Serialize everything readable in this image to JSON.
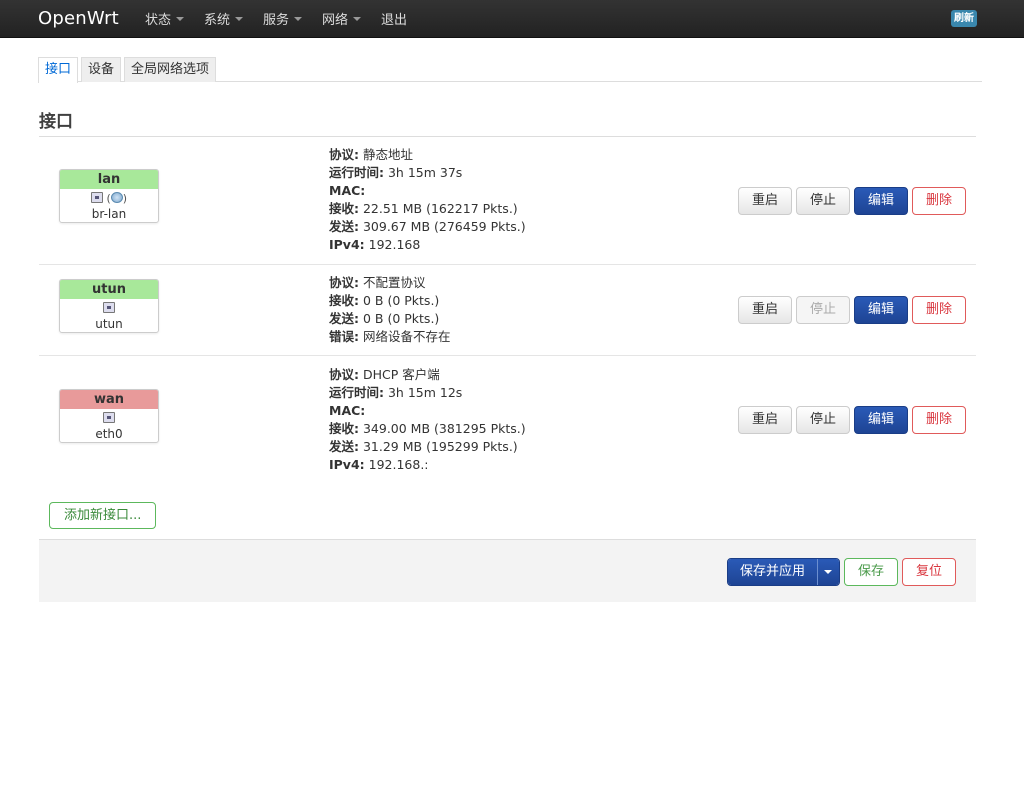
{
  "navbar": {
    "brand": "OpenWrt",
    "menus": [
      "状态",
      "系统",
      "服务",
      "网络"
    ],
    "logout": "退出",
    "refresh": "刷新"
  },
  "tabs": [
    {
      "label": "接口",
      "active": true
    },
    {
      "label": "设备",
      "active": false
    },
    {
      "label": "全局网络选项",
      "active": false
    }
  ],
  "section_title": "接口",
  "interfaces": [
    {
      "name": "lan",
      "color": "#a8e89a",
      "device": "br-lan",
      "icons": [
        "port-icon",
        "globe-icon"
      ],
      "info": [
        {
          "k": "协议:",
          "v": " 静态地址"
        },
        {
          "k": "运行时间:",
          "v": " 3h 15m 37s"
        },
        {
          "k": "MAC:",
          "v": ""
        },
        {
          "k": "接收:",
          "v": " 22.51 MB (162217 Pkts.)"
        },
        {
          "k": "发送:",
          "v": " 309.67 MB (276459 Pkts.)"
        },
        {
          "k": "IPv4:",
          "v": " 192.168"
        }
      ],
      "stop_disabled": false
    },
    {
      "name": "utun",
      "color": "#a8e89a",
      "device": "utun",
      "icons": [
        "port-icon"
      ],
      "info": [
        {
          "k": "协议:",
          "v": " 不配置协议"
        },
        {
          "k": "接收:",
          "v": " 0 B (0 Pkts.)"
        },
        {
          "k": "发送:",
          "v": " 0 B (0 Pkts.)"
        },
        {
          "k": "错误:",
          "v": " 网络设备不存在"
        }
      ],
      "stop_disabled": true
    },
    {
      "name": "wan",
      "color": "#e89a9a",
      "device": "eth0",
      "icons": [
        "port-icon"
      ],
      "info": [
        {
          "k": "协议:",
          "v": " DHCP 客户端"
        },
        {
          "k": "运行时间:",
          "v": " 3h 15m 12s"
        },
        {
          "k": "MAC:",
          "v": ""
        },
        {
          "k": "接收:",
          "v": " 349.00 MB (381295 Pkts.)"
        },
        {
          "k": "发送:",
          "v": " 31.29 MB (195299 Pkts.)"
        },
        {
          "k": "IPv4:",
          "v": " 192.168.:"
        }
      ],
      "stop_disabled": false
    }
  ],
  "row_buttons": {
    "restart": "重启",
    "stop": "停止",
    "edit": "编辑",
    "delete": "删除"
  },
  "add_interface": "添加新接口...",
  "footer": {
    "save_apply": "保存并应用",
    "save": "保存",
    "reset": "复位"
  }
}
